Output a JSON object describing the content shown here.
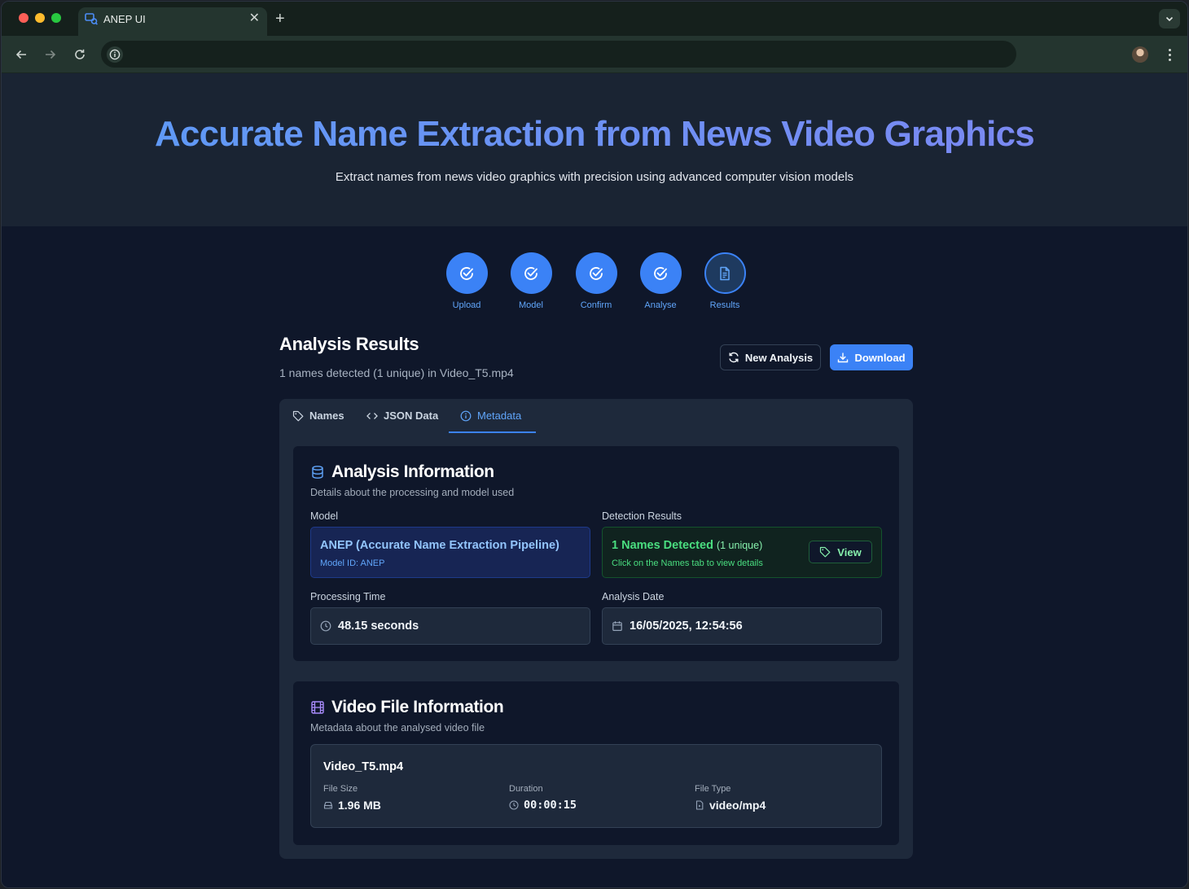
{
  "browser": {
    "tab_title": "ANEP UI",
    "new_tab_symbol": "+",
    "close_symbol": "✕"
  },
  "hero": {
    "title": "Accurate Name Extraction from News Video Graphics",
    "subtitle": "Extract names from news video graphics with precision using advanced computer vision models"
  },
  "steps": [
    {
      "label": "Upload",
      "state": "done"
    },
    {
      "label": "Model",
      "state": "done"
    },
    {
      "label": "Confirm",
      "state": "done"
    },
    {
      "label": "Analyse",
      "state": "done"
    },
    {
      "label": "Results",
      "state": "current"
    }
  ],
  "results": {
    "title": "Analysis Results",
    "subtitle": "1 names detected (1 unique) in Video_T5.mp4",
    "new_analysis_label": "New Analysis",
    "download_label": "Download"
  },
  "tabs": [
    {
      "label": "Names",
      "icon": "tag-icon"
    },
    {
      "label": "JSON Data",
      "icon": "code-icon"
    },
    {
      "label": "Metadata",
      "icon": "info-icon",
      "active": true
    }
  ],
  "analysis_info": {
    "title": "Analysis Information",
    "description": "Details about the processing and model used",
    "model_label": "Model",
    "model_name": "ANEP (Accurate Name Extraction Pipeline)",
    "model_id": "Model ID: ANEP",
    "detection_label": "Detection Results",
    "detection_main": "1 Names Detected",
    "detection_unique": "(1 unique)",
    "detection_hint": "Click on the Names tab to view details",
    "view_label": "View",
    "processing_label": "Processing Time",
    "processing_value": "48.15 seconds",
    "date_label": "Analysis Date",
    "date_value": "16/05/2025, 12:54:56"
  },
  "video_info": {
    "title": "Video File Information",
    "description": "Metadata about the analysed video file",
    "file_name": "Video_T5.mp4",
    "file_size_label": "File Size",
    "file_size_value": "1.96 MB",
    "duration_label": "Duration",
    "duration_value": "00:00:15",
    "file_type_label": "File Type",
    "file_type_value": "video/mp4"
  },
  "colors": {
    "accent": "#3b82f6",
    "success": "#4ade80",
    "page_bg": "#0f172a"
  }
}
